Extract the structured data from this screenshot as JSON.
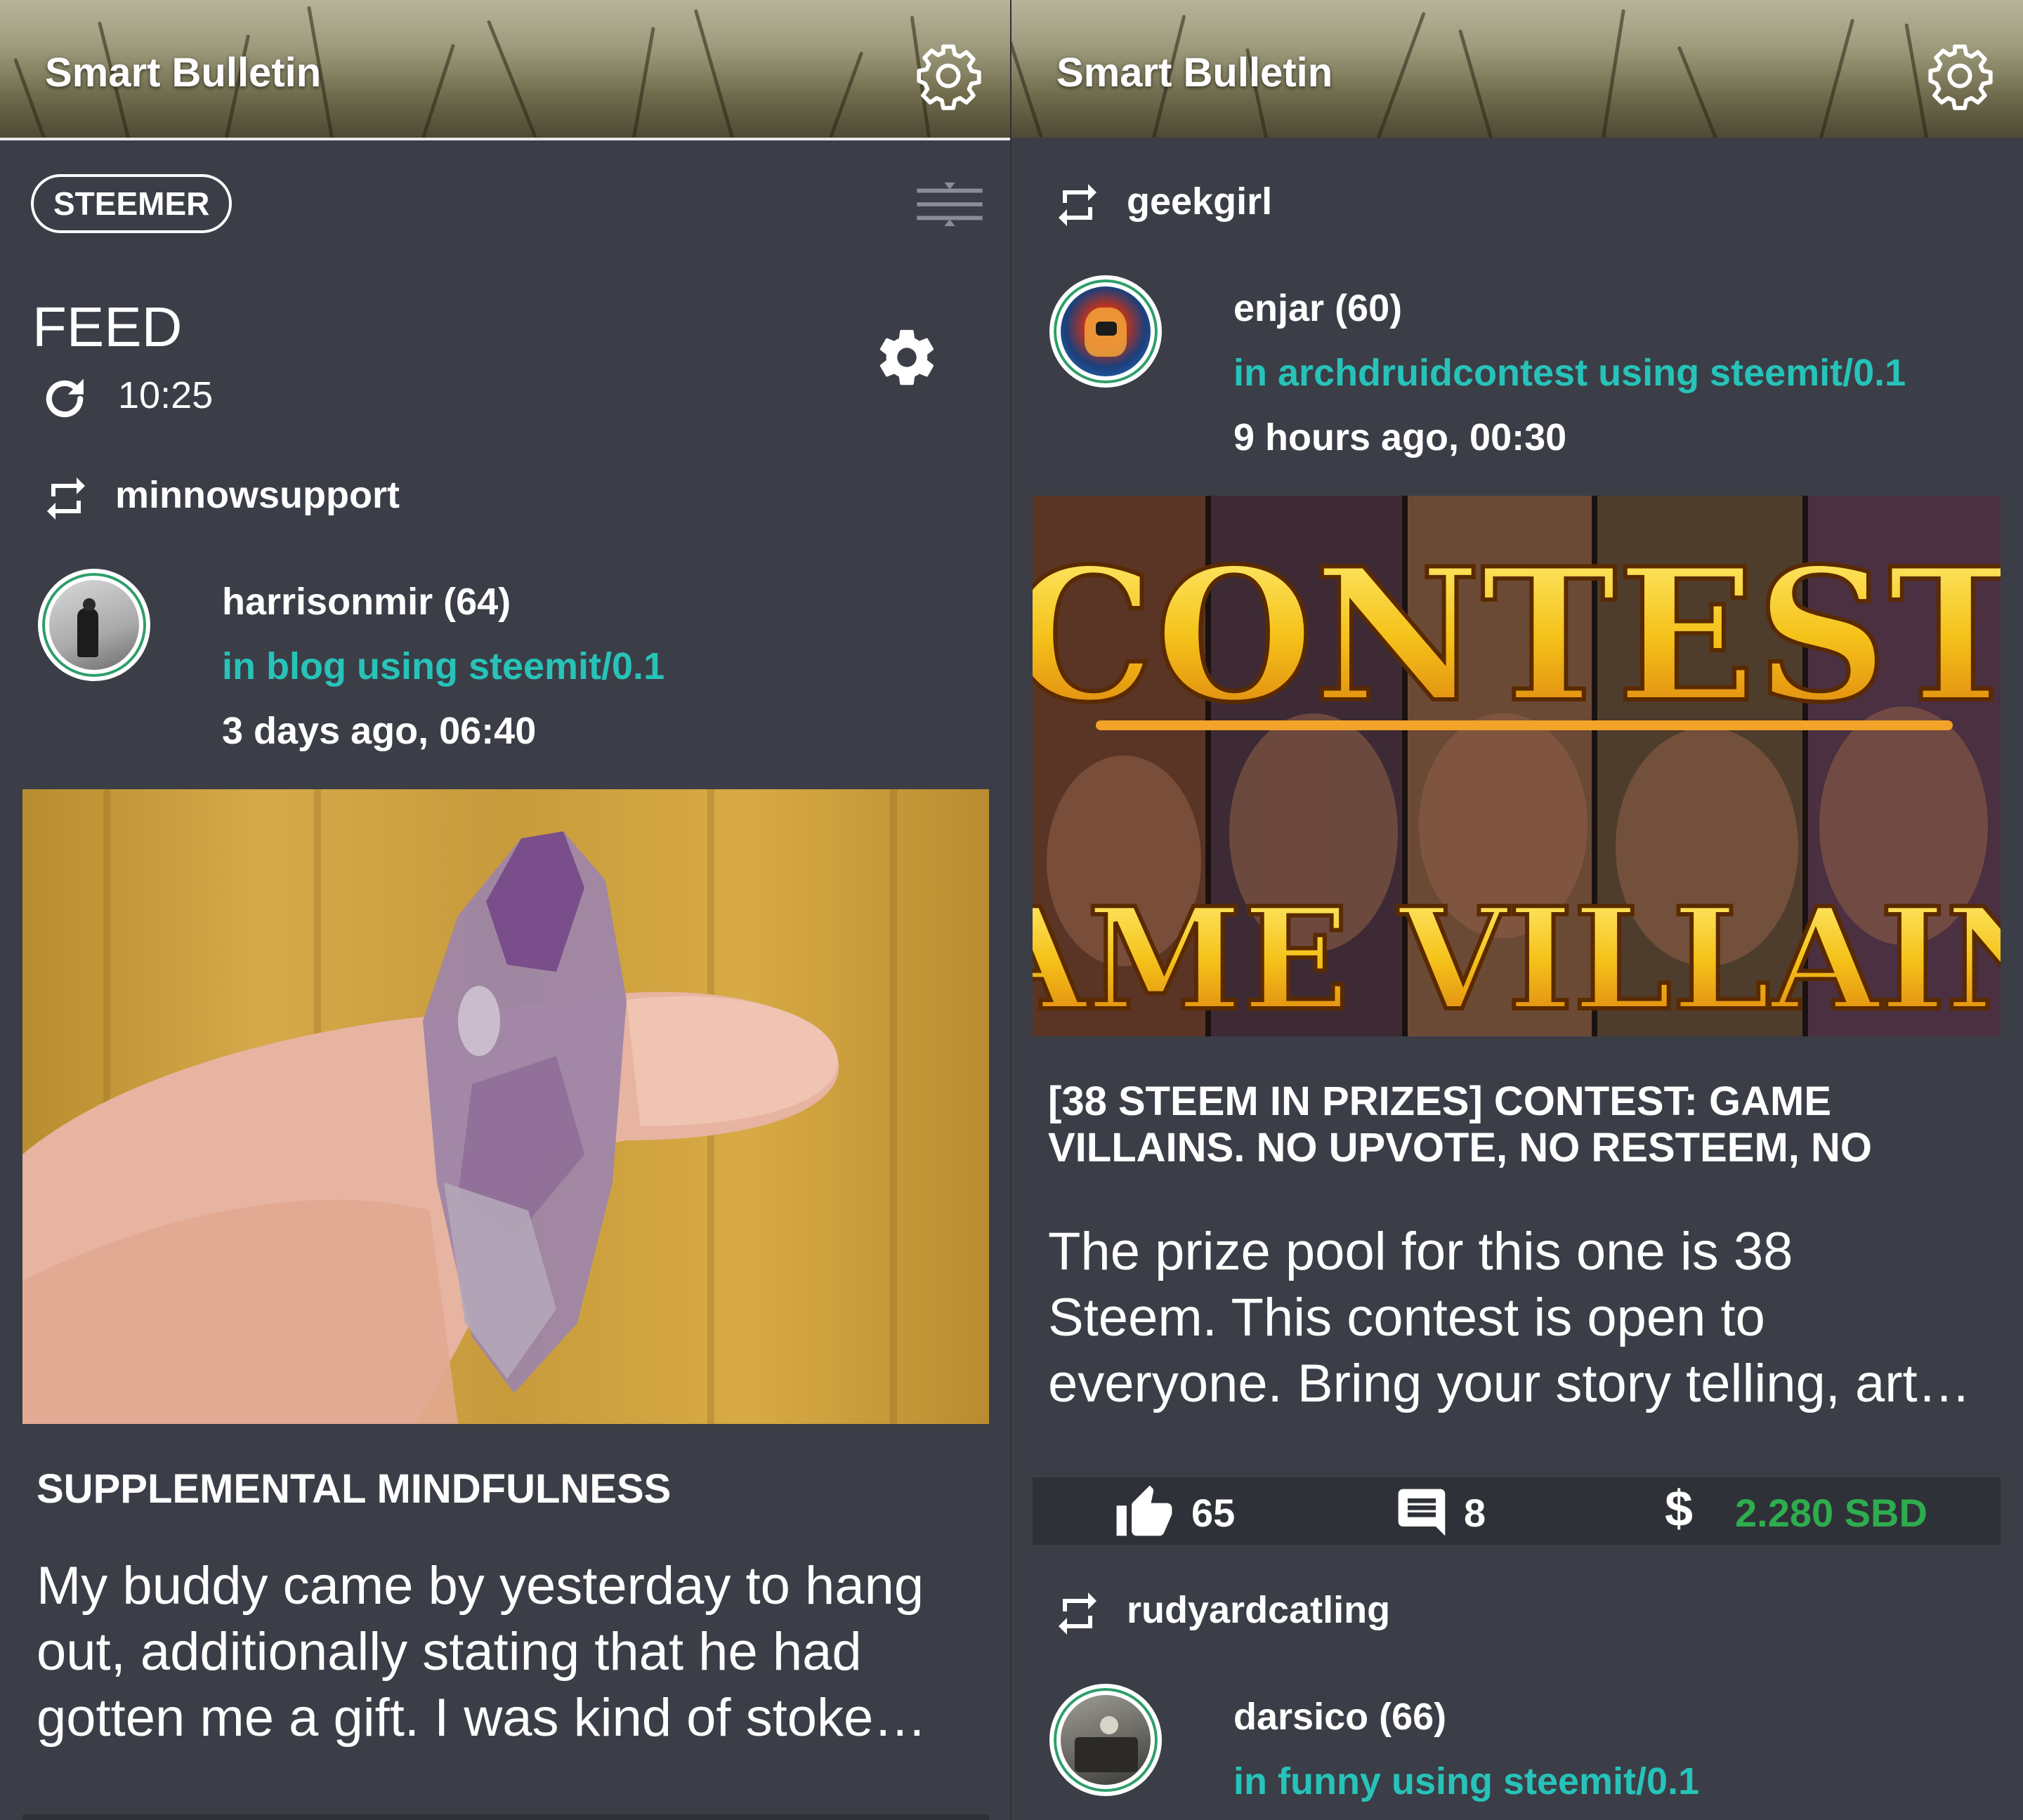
{
  "left": {
    "app_title": "Smart Bulletin",
    "chip_label": "STEEMER",
    "feed_title": "FEED",
    "refresh_time": "10:25",
    "reblogger": "minnowsupport",
    "author": "harrisonmir (64)",
    "category": "in blog using steemit/0.1",
    "when": "3 days ago, 06:40",
    "post_title": "SUPPLEMENTAL MINDFULNESS",
    "post_excerpt_lines": [
      "My buddy came by yesterday to hang",
      "out, additionally stating that he had",
      "gotten me a gift. I was kind of stoke…"
    ]
  },
  "right": {
    "app_title": "Smart Bulletin",
    "post1": {
      "reblogger": "geekgirl",
      "author": "enjar (60)",
      "category": "in archdruidcontest using steemit/0.1",
      "when": "9 hours ago, 00:30",
      "image_text_top": "CONTEST",
      "image_text_bottom": "GAME VILLAINS",
      "post_title_lines": [
        "[38 STEEM IN PRIZES] CONTEST: GAME",
        "VILLAINS. NO UPVOTE, NO RESTEEM, NO"
      ],
      "post_excerpt_lines": [
        "The prize pool for this one is 38",
        "Steem. This contest is open to",
        "everyone. Bring your story telling, art…"
      ],
      "votes": "65",
      "comments": "8",
      "payout": "2.280 SBD"
    },
    "post2": {
      "reblogger": "rudyardcatling",
      "author": "darsico (66)",
      "category": "in funny using steemit/0.1"
    }
  },
  "colors": {
    "background": "#3b3e47",
    "accent_teal": "#27c3b9",
    "payout_green": "#2eac4e",
    "stats_bar": "#2f3138"
  },
  "icons": [
    "settings-gear-outline-icon",
    "filter-sliders-icon",
    "refresh-icon",
    "settings-gear-icon",
    "resteem-icon",
    "thumbs-up-icon",
    "comment-icon",
    "dollar-icon"
  ]
}
